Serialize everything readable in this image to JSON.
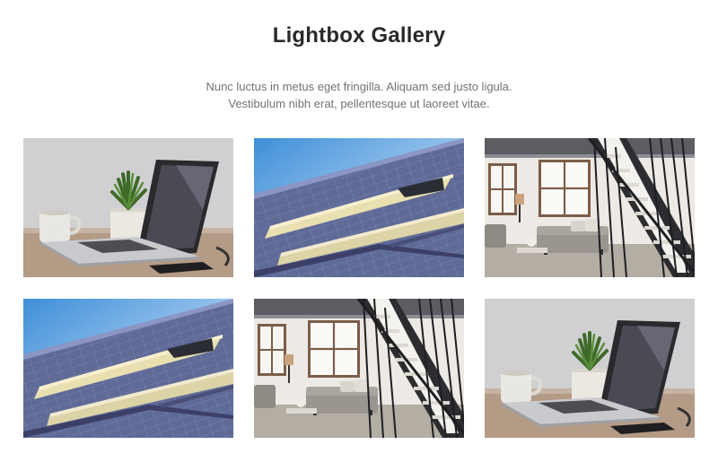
{
  "gallery": {
    "title": "Lightbox Gallery",
    "description_lines": [
      "Nunc luctus in metus eget fringilla. Aliquam sed justo ligula.",
      "Vestibulum nibh erat, pellentesque ut laoreet vitae."
    ],
    "images": [
      {
        "subject": "laptop-desk"
      },
      {
        "subject": "building-facade"
      },
      {
        "subject": "loft-staircase"
      },
      {
        "subject": "building-facade"
      },
      {
        "subject": "loft-staircase"
      },
      {
        "subject": "laptop-desk"
      }
    ]
  }
}
